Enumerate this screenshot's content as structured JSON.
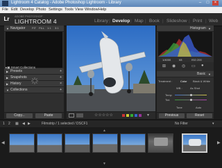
{
  "window": {
    "title": "Lightroom 4 Catalog - Adobe Photoshop Lightroom - Library",
    "controls": [
      "–",
      "□",
      "×"
    ]
  },
  "menu": [
    "File",
    "Edit",
    "Develop",
    "Photo",
    "Settings",
    "Tools",
    "View",
    "Window",
    "Help"
  ],
  "identity": {
    "logo": "Lr",
    "adobe_text": "ADOBE PHOTOSHOP",
    "product": "LIGHTROOM 4"
  },
  "modules": [
    "Library",
    "Develop",
    "Map",
    "Book",
    "Slideshow",
    "Print",
    "Web"
  ],
  "active_module": "Develop",
  "left_panel": {
    "navigator": {
      "label": "Navigator",
      "options": [
        "FIT",
        "FILL",
        "1:1",
        "3:1"
      ]
    },
    "presets": "Presets",
    "snapshots": "Snapshots",
    "history": "History",
    "collections": {
      "label": "Collections",
      "items": [
        "Smart Collections"
      ]
    },
    "copy_button": "Copy...",
    "paste_button": "Paste"
  },
  "filmstrip_bar": {
    "page_1": "1",
    "page_2": "2",
    "info": "Filmstrip / 1 selected / DSCF1",
    "filter": "No Filter"
  },
  "right_panel": {
    "histogram": "Histogram",
    "exif": [
      "1/4000",
      "f/8",
      "ISO 200"
    ],
    "basic": "Basic",
    "treatment_label": "Treatment :",
    "treatment_color": "Color",
    "treatment_bw": "Black & White",
    "wb_label": "WB :",
    "wb_value": "As Shot",
    "temp_label": "Temp",
    "tint_label": "Tint",
    "tone_label": "Tone",
    "tone_value": "Auto",
    "previous_button": "Previous",
    "reset_button": "Reset"
  },
  "colors": {
    "accent": "#7fa6cf",
    "panel": "#2f2f2f",
    "sky": "#3f7fce"
  }
}
